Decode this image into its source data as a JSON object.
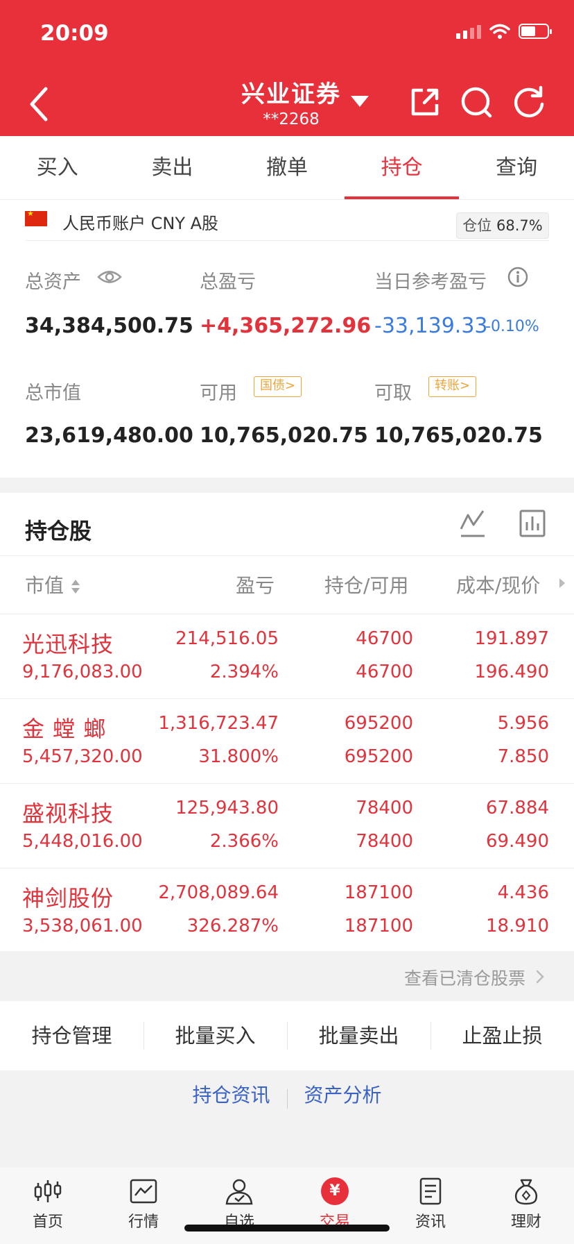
{
  "status_bar": {
    "time": "20:09"
  },
  "header": {
    "title": "兴业证券",
    "account_mask": "**2268"
  },
  "tabs": [
    {
      "label": "买入",
      "active": false
    },
    {
      "label": "卖出",
      "active": false
    },
    {
      "label": "撤单",
      "active": false
    },
    {
      "label": "持仓",
      "active": true
    },
    {
      "label": "查询",
      "active": false
    }
  ],
  "account": {
    "label": "人民币账户 CNY A股",
    "position_ratio_label": "仓位",
    "position_ratio": "68.7%",
    "total_assets_label": "总资产",
    "total_assets": "34,384,500.75",
    "total_pnl_label": "总盈亏",
    "total_pnl": "+4,365,272.96",
    "day_pnl_label": "当日参考盈亏",
    "day_pnl": "-33,139.33",
    "day_pnl_pct": "-0.10%",
    "market_value_label": "总市值",
    "market_value": "23,619,480.00",
    "available_label": "可用",
    "available": "10,765,020.75",
    "treasury_btn": "国债>",
    "withdrawable_label": "可取",
    "withdrawable": "10,765,020.75",
    "transfer_btn": "转账>"
  },
  "holdings": {
    "title": "持仓股",
    "columns": {
      "market_value": "市值",
      "pnl": "盈亏",
      "qty": "持仓/可用",
      "cost": "成本/现价"
    },
    "rows": [
      {
        "name": "光迅科技",
        "market_value": "9,176,083.00",
        "pnl": "214,516.05",
        "pnl_pct": "2.394%",
        "qty": "46700",
        "available": "46700",
        "cost": "191.897",
        "price": "196.490"
      },
      {
        "name": "金 螳 螂",
        "market_value": "5,457,320.00",
        "pnl": "1,316,723.47",
        "pnl_pct": "31.800%",
        "qty": "695200",
        "available": "695200",
        "cost": "5.956",
        "price": "7.850"
      },
      {
        "name": "盛视科技",
        "market_value": "5,448,016.00",
        "pnl": "125,943.80",
        "pnl_pct": "2.366%",
        "qty": "78400",
        "available": "78400",
        "cost": "67.884",
        "price": "69.490"
      },
      {
        "name": "神剑股份",
        "market_value": "3,538,061.00",
        "pnl": "2,708,089.64",
        "pnl_pct": "326.287%",
        "qty": "187100",
        "available": "187100",
        "cost": "4.436",
        "price": "18.910"
      }
    ]
  },
  "cleared_link": "查看已清仓股票",
  "actions": [
    "持仓管理",
    "批量买入",
    "批量卖出",
    "止盈止损"
  ],
  "links": [
    "持仓资讯",
    "资产分析"
  ],
  "tabbar": [
    {
      "label": "首页",
      "icon": "candlestick-icon",
      "active": false
    },
    {
      "label": "行情",
      "icon": "chart-icon",
      "active": false
    },
    {
      "label": "自选",
      "icon": "person-check-icon",
      "active": false
    },
    {
      "label": "交易",
      "icon": "yen-icon",
      "active": true
    },
    {
      "label": "资讯",
      "icon": "document-icon",
      "active": false
    },
    {
      "label": "理财",
      "icon": "money-bag-icon",
      "active": false
    }
  ],
  "colors": {
    "brand": "#e8303b",
    "gain": "#e0333c",
    "loss": "#3a7be0",
    "pill": "#f0a43a"
  }
}
